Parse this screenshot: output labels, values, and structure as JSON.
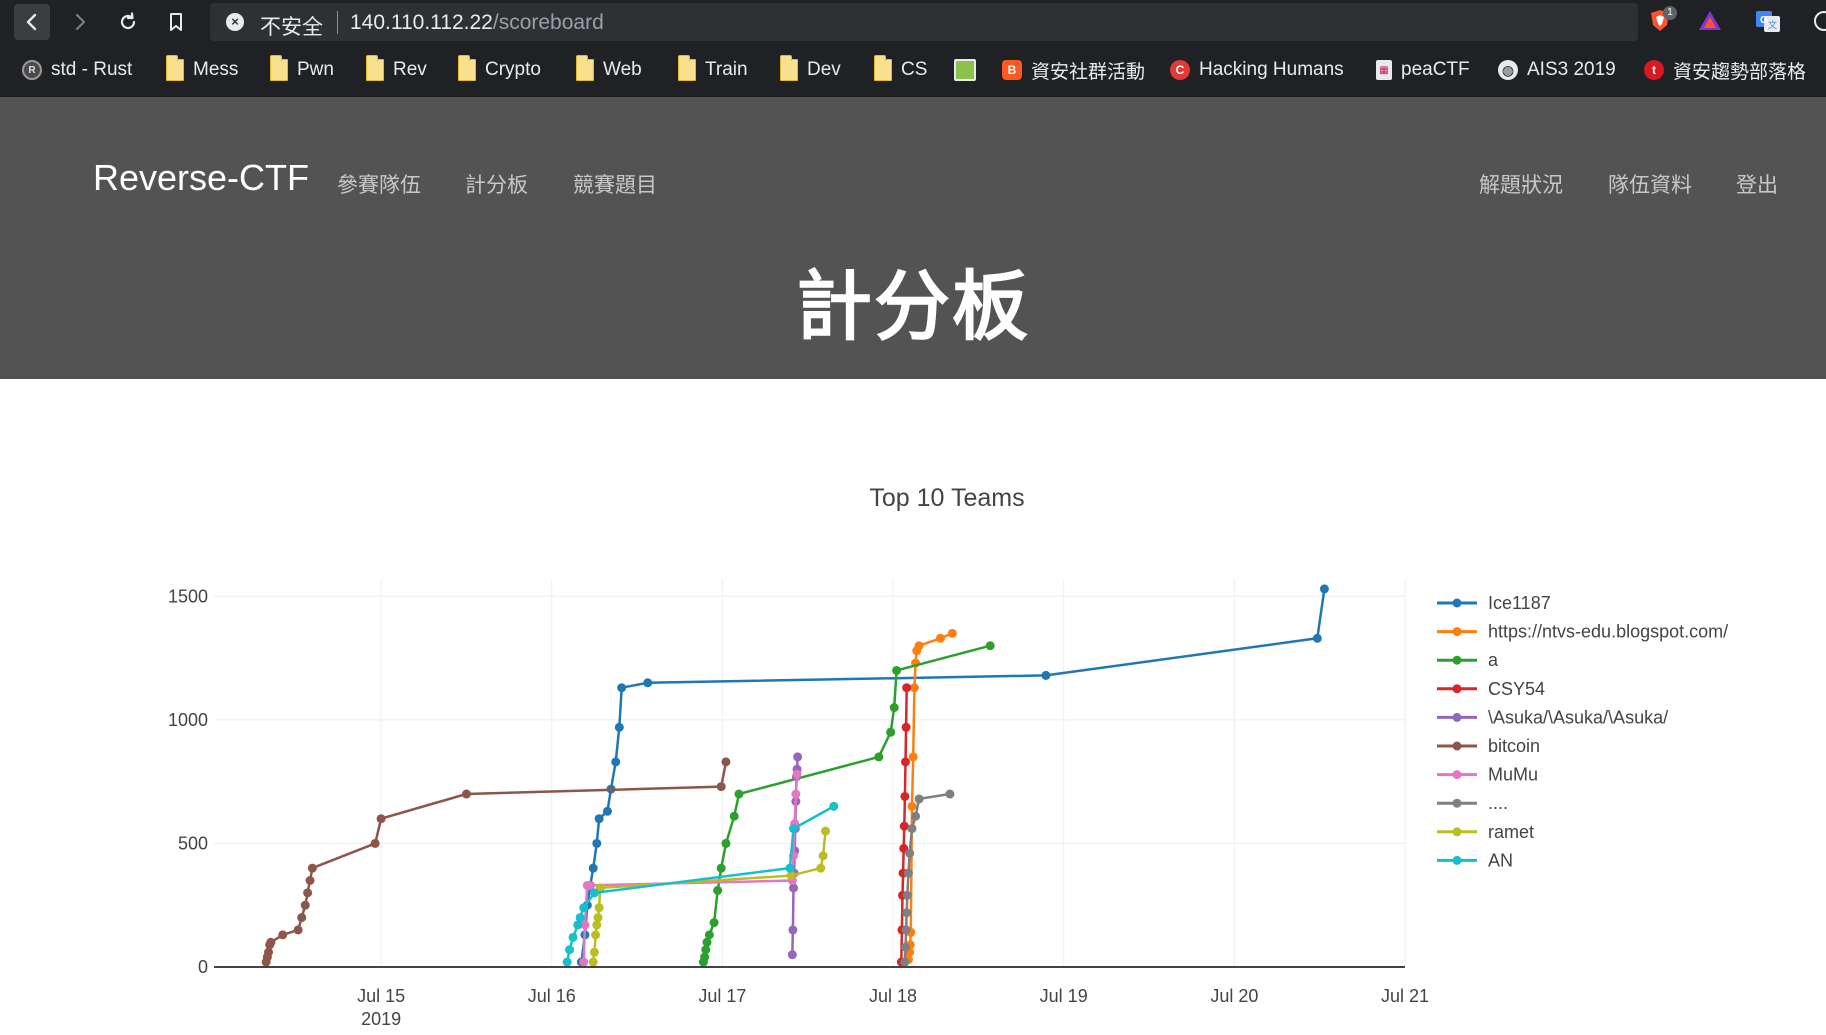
{
  "browser": {
    "security_label": "不安全",
    "url_host": "140.110.112.22",
    "url_path": "/scoreboard",
    "extension_badge": "1"
  },
  "bookmarks": [
    {
      "label": "std - Rust",
      "icon": "rust-icon"
    },
    {
      "label": "Mess",
      "icon": "folder-icon"
    },
    {
      "label": "Pwn",
      "icon": "folder-icon"
    },
    {
      "label": "Rev",
      "icon": "folder-icon"
    },
    {
      "label": "Crypto",
      "icon": "folder-icon"
    },
    {
      "label": "Web",
      "icon": "folder-icon"
    },
    {
      "label": "Train",
      "icon": "folder-icon"
    },
    {
      "label": "Dev",
      "icon": "folder-icon"
    },
    {
      "label": "CS",
      "icon": "folder-icon"
    },
    {
      "label": "",
      "icon": "image-favicon"
    },
    {
      "label": "資安社群活動",
      "icon": "blogger-icon"
    },
    {
      "label": "Hacking Humans",
      "icon": "cyberwire-icon"
    },
    {
      "label": "peaCTF",
      "icon": "calculator-icon"
    },
    {
      "label": "AIS3 2019",
      "icon": "globe-icon"
    },
    {
      "label": "資安趨勢部落格",
      "icon": "trendmicro-icon"
    }
  ],
  "site": {
    "brand": "Reverse-CTF",
    "nav_left": [
      "參賽隊伍",
      "計分板",
      "競賽題目"
    ],
    "nav_right": [
      "解題狀況",
      "隊伍資料",
      "登出"
    ],
    "page_title": "計分板"
  },
  "chart_data": {
    "type": "line",
    "title": "Top 10 Teams",
    "xlabel": "",
    "ylabel": "",
    "x_ticks": [
      "Jul 15",
      "Jul 16",
      "Jul 17",
      "Jul 18",
      "Jul 19",
      "Jul 20",
      "Jul 21"
    ],
    "x_tick_year": "2019",
    "y_ticks": [
      "0",
      "500",
      "1000",
      "1500"
    ],
    "xlim": [
      "2019-07-14 00:30",
      "2019-07-21 00:00"
    ],
    "ylim": [
      0,
      1570
    ],
    "grid": true,
    "legend_position": "right",
    "series": [
      {
        "name": "Ice1187",
        "color": "#1f77b4",
        "points": [
          [
            "2019-07-16 04:10",
            20
          ],
          [
            "2019-07-16 04:40",
            130
          ],
          [
            "2019-07-16 05:00",
            250
          ],
          [
            "2019-07-16 05:25",
            330
          ],
          [
            "2019-07-16 05:50",
            400
          ],
          [
            "2019-07-16 06:20",
            500
          ],
          [
            "2019-07-16 06:40",
            600
          ],
          [
            "2019-07-16 07:50",
            630
          ],
          [
            "2019-07-16 08:20",
            720
          ],
          [
            "2019-07-16 09:00",
            830
          ],
          [
            "2019-07-16 09:30",
            970
          ],
          [
            "2019-07-16 09:50",
            1130
          ],
          [
            "2019-07-16 13:30",
            1150
          ],
          [
            "2019-07-18 21:30",
            1180
          ],
          [
            "2019-07-20 11:40",
            1330
          ],
          [
            "2019-07-20 12:40",
            1530
          ]
        ]
      },
      {
        "name": "https://ntvs-edu.blogspot.com/",
        "color": "#ff7f0e",
        "points": [
          [
            "2019-07-18 02:10",
            30
          ],
          [
            "2019-07-18 02:20",
            60
          ],
          [
            "2019-07-18 02:25",
            90
          ],
          [
            "2019-07-18 02:30",
            140
          ],
          [
            "2019-07-18 02:40",
            650
          ],
          [
            "2019-07-18 02:50",
            850
          ],
          [
            "2019-07-18 03:00",
            1130
          ],
          [
            "2019-07-18 03:10",
            1230
          ],
          [
            "2019-07-18 03:20",
            1280
          ],
          [
            "2019-07-18 03:40",
            1300
          ],
          [
            "2019-07-18 06:40",
            1330
          ],
          [
            "2019-07-18 08:20",
            1350
          ]
        ]
      },
      {
        "name": "a",
        "color": "#2ca02c",
        "points": [
          [
            "2019-07-16 21:20",
            20
          ],
          [
            "2019-07-16 21:30",
            40
          ],
          [
            "2019-07-16 21:40",
            70
          ],
          [
            "2019-07-16 21:50",
            100
          ],
          [
            "2019-07-16 22:10",
            130
          ],
          [
            "2019-07-16 22:50",
            180
          ],
          [
            "2019-07-16 23:20",
            310
          ],
          [
            "2019-07-16 23:50",
            400
          ],
          [
            "2019-07-17 00:30",
            500
          ],
          [
            "2019-07-17 01:40",
            610
          ],
          [
            "2019-07-17 02:20",
            700
          ],
          [
            "2019-07-17 22:00",
            850
          ],
          [
            "2019-07-17 23:40",
            950
          ],
          [
            "2019-07-18 00:10",
            1050
          ],
          [
            "2019-07-18 00:30",
            1200
          ],
          [
            "2019-07-18 13:40",
            1300
          ]
        ]
      },
      {
        "name": "CSY54",
        "color": "#d62728",
        "points": [
          [
            "2019-07-18 01:10",
            20
          ],
          [
            "2019-07-18 01:15",
            150
          ],
          [
            "2019-07-18 01:20",
            290
          ],
          [
            "2019-07-18 01:25",
            380
          ],
          [
            "2019-07-18 01:30",
            480
          ],
          [
            "2019-07-18 01:35",
            570
          ],
          [
            "2019-07-18 01:40",
            690
          ],
          [
            "2019-07-18 01:45",
            830
          ],
          [
            "2019-07-18 01:50",
            970
          ],
          [
            "2019-07-18 01:55",
            1130
          ]
        ]
      },
      {
        "name": "\\Asuka/\\Asuka/\\Asuka/",
        "color": "#9467bd",
        "points": [
          [
            "2019-07-17 09:50",
            50
          ],
          [
            "2019-07-17 09:55",
            150
          ],
          [
            "2019-07-17 10:00",
            320
          ],
          [
            "2019-07-17 10:05",
            380
          ],
          [
            "2019-07-17 10:10",
            470
          ],
          [
            "2019-07-17 10:15",
            560
          ],
          [
            "2019-07-17 10:20",
            670
          ],
          [
            "2019-07-17 10:25",
            770
          ],
          [
            "2019-07-17 10:30",
            800
          ],
          [
            "2019-07-17 10:35",
            850
          ]
        ]
      },
      {
        "name": "bitcoin",
        "color": "#8c564b",
        "points": [
          [
            "2019-07-14 07:50",
            20
          ],
          [
            "2019-07-14 08:00",
            40
          ],
          [
            "2019-07-14 08:10",
            60
          ],
          [
            "2019-07-14 08:20",
            90
          ],
          [
            "2019-07-14 08:30",
            100
          ],
          [
            "2019-07-14 10:10",
            130
          ],
          [
            "2019-07-14 12:20",
            150
          ],
          [
            "2019-07-14 12:50",
            200
          ],
          [
            "2019-07-14 13:20",
            250
          ],
          [
            "2019-07-14 13:40",
            300
          ],
          [
            "2019-07-14 14:00",
            350
          ],
          [
            "2019-07-14 14:20",
            400
          ],
          [
            "2019-07-14 23:10",
            500
          ],
          [
            "2019-07-15 00:00",
            600
          ],
          [
            "2019-07-15 12:00",
            700
          ],
          [
            "2019-07-16 23:50",
            730
          ],
          [
            "2019-07-17 00:30",
            830
          ]
        ]
      },
      {
        "name": "MuMu",
        "color": "#e377c2",
        "points": [
          [
            "2019-07-16 04:30",
            20
          ],
          [
            "2019-07-16 04:40",
            170
          ],
          [
            "2019-07-16 05:00",
            330
          ],
          [
            "2019-07-16 05:20",
            330
          ],
          [
            "2019-07-17 09:50",
            350
          ],
          [
            "2019-07-17 10:00",
            450
          ],
          [
            "2019-07-17 10:10",
            580
          ],
          [
            "2019-07-17 10:20",
            700
          ],
          [
            "2019-07-17 10:30",
            780
          ]
        ]
      },
      {
        "name": "....",
        "color": "#7f7f7f",
        "points": [
          [
            "2019-07-18 01:40",
            20
          ],
          [
            "2019-07-18 01:45",
            80
          ],
          [
            "2019-07-18 01:50",
            150
          ],
          [
            "2019-07-18 01:55",
            220
          ],
          [
            "2019-07-18 02:00",
            290
          ],
          [
            "2019-07-18 02:10",
            380
          ],
          [
            "2019-07-18 02:20",
            460
          ],
          [
            "2019-07-18 02:40",
            560
          ],
          [
            "2019-07-18 03:10",
            610
          ],
          [
            "2019-07-18 03:40",
            680
          ],
          [
            "2019-07-18 08:00",
            700
          ]
        ]
      },
      {
        "name": "ramet",
        "color": "#bcbd22",
        "points": [
          [
            "2019-07-16 05:50",
            20
          ],
          [
            "2019-07-16 06:00",
            60
          ],
          [
            "2019-07-16 06:10",
            130
          ],
          [
            "2019-07-16 06:20",
            170
          ],
          [
            "2019-07-16 06:30",
            200
          ],
          [
            "2019-07-16 06:40",
            240
          ],
          [
            "2019-07-16 06:50",
            320
          ],
          [
            "2019-07-17 09:40",
            370
          ],
          [
            "2019-07-17 13:50",
            400
          ],
          [
            "2019-07-17 14:10",
            450
          ],
          [
            "2019-07-17 14:30",
            550
          ]
        ]
      },
      {
        "name": "AN",
        "color": "#17becf",
        "points": [
          [
            "2019-07-16 02:10",
            20
          ],
          [
            "2019-07-16 02:30",
            70
          ],
          [
            "2019-07-16 03:00",
            120
          ],
          [
            "2019-07-16 03:40",
            170
          ],
          [
            "2019-07-16 04:00",
            200
          ],
          [
            "2019-07-16 04:30",
            240
          ],
          [
            "2019-07-16 06:00",
            300
          ],
          [
            "2019-07-17 09:30",
            400
          ],
          [
            "2019-07-17 10:00",
            560
          ],
          [
            "2019-07-17 15:40",
            650
          ]
        ]
      }
    ]
  }
}
